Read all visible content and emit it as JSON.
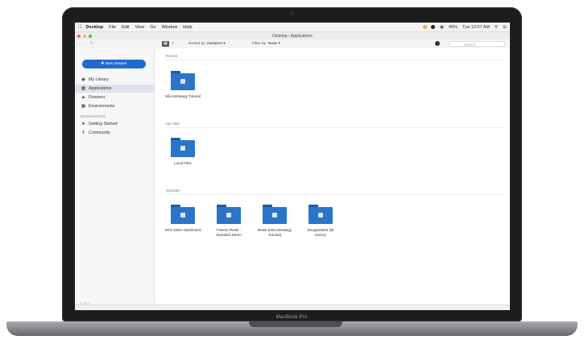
{
  "menubar": {
    "app": "Desktop",
    "items": [
      "File",
      "Edit",
      "View",
      "Go",
      "Window",
      "Help"
    ],
    "battery": "49%",
    "clock": "Tue 12:07 AM"
  },
  "window": {
    "title": "Desktop › Applications"
  },
  "toolbar": {
    "sort_label": "Sorted by:",
    "sort_value": "Dossiers",
    "filter_label": "Filter by:",
    "filter_value": "None",
    "search_placeholder": "Search"
  },
  "sidebar": {
    "new_button": "New Dossier",
    "items": [
      {
        "label": "My Library",
        "icon": "library-icon"
      },
      {
        "label": "Applications",
        "icon": "applications-icon"
      },
      {
        "label": "Dossiers",
        "icon": "dossiers-icon"
      },
      {
        "label": "Environments",
        "icon": "environments-icon"
      }
    ],
    "resources_heading": "RESOURCES",
    "resources": [
      {
        "label": "Getting Started",
        "icon": "rocket-icon"
      },
      {
        "label": "Community",
        "icon": "community-icon"
      }
    ],
    "footer": "v 11.0"
  },
  "sections": [
    {
      "label": "Recent",
      "tiles": [
        {
          "name": "MicroStrategy Tutorial"
        }
      ]
    },
    {
      "label": "My Files",
      "tiles": [
        {
          "name": "Local Files"
        }
      ]
    },
    {
      "label": "Samples",
      "tiles": [
        {
          "name": "DPS Sales Dashboard"
        },
        {
          "name": "Fintech Retail - Standard Demo"
        },
        {
          "name": "Retail (MicroStrategy Tutorial)"
        },
        {
          "name": "ShopperMart (BI Demo)"
        }
      ]
    }
  ],
  "device": {
    "brand": "MacBook Pro"
  },
  "colors": {
    "accent": "#1f6bd0",
    "folder": "#2a74c9"
  }
}
